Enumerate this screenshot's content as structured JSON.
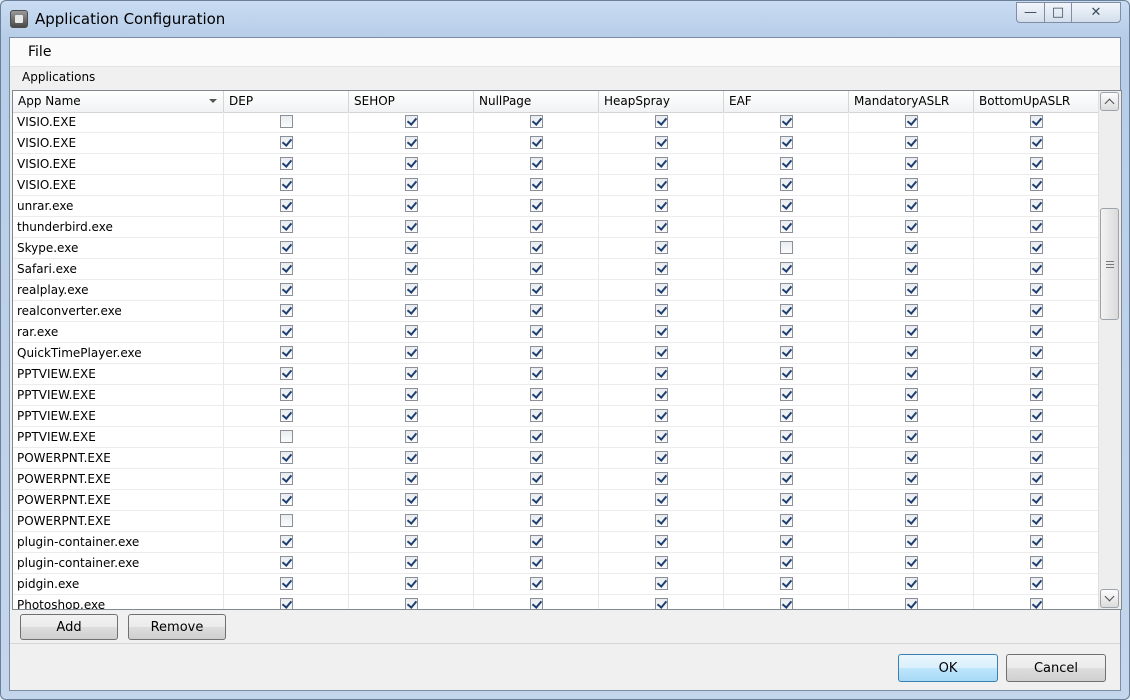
{
  "window": {
    "title": "Application Configuration"
  },
  "caption": {
    "minimize": "—",
    "maximize": "□",
    "close": "✕"
  },
  "menu": {
    "file": "File"
  },
  "grid": {
    "group_label": "Applications",
    "columns": [
      "App Name",
      "DEP",
      "SEHOP",
      "NullPage",
      "HeapSpray",
      "EAF",
      "MandatoryASLR",
      "BottomUpASLR"
    ],
    "rows": [
      {
        "name": "VISIO.EXE",
        "checks": [
          false,
          true,
          true,
          true,
          true,
          true,
          true
        ]
      },
      {
        "name": "VISIO.EXE",
        "checks": [
          true,
          true,
          true,
          true,
          true,
          true,
          true
        ]
      },
      {
        "name": "VISIO.EXE",
        "checks": [
          true,
          true,
          true,
          true,
          true,
          true,
          true
        ]
      },
      {
        "name": "VISIO.EXE",
        "checks": [
          true,
          true,
          true,
          true,
          true,
          true,
          true
        ]
      },
      {
        "name": "unrar.exe",
        "checks": [
          true,
          true,
          true,
          true,
          true,
          true,
          true
        ]
      },
      {
        "name": "thunderbird.exe",
        "checks": [
          true,
          true,
          true,
          true,
          true,
          true,
          true
        ]
      },
      {
        "name": "Skype.exe",
        "checks": [
          true,
          true,
          true,
          true,
          false,
          true,
          true
        ]
      },
      {
        "name": "Safari.exe",
        "checks": [
          true,
          true,
          true,
          true,
          true,
          true,
          true
        ]
      },
      {
        "name": "realplay.exe",
        "checks": [
          true,
          true,
          true,
          true,
          true,
          true,
          true
        ]
      },
      {
        "name": "realconverter.exe",
        "checks": [
          true,
          true,
          true,
          true,
          true,
          true,
          true
        ]
      },
      {
        "name": "rar.exe",
        "checks": [
          true,
          true,
          true,
          true,
          true,
          true,
          true
        ]
      },
      {
        "name": "QuickTimePlayer.exe",
        "checks": [
          true,
          true,
          true,
          true,
          true,
          true,
          true
        ]
      },
      {
        "name": "PPTVIEW.EXE",
        "checks": [
          true,
          true,
          true,
          true,
          true,
          true,
          true
        ]
      },
      {
        "name": "PPTVIEW.EXE",
        "checks": [
          true,
          true,
          true,
          true,
          true,
          true,
          true
        ]
      },
      {
        "name": "PPTVIEW.EXE",
        "checks": [
          true,
          true,
          true,
          true,
          true,
          true,
          true
        ]
      },
      {
        "name": "PPTVIEW.EXE",
        "checks": [
          false,
          true,
          true,
          true,
          true,
          true,
          true
        ]
      },
      {
        "name": "POWERPNT.EXE",
        "checks": [
          true,
          true,
          true,
          true,
          true,
          true,
          true
        ]
      },
      {
        "name": "POWERPNT.EXE",
        "checks": [
          true,
          true,
          true,
          true,
          true,
          true,
          true
        ]
      },
      {
        "name": "POWERPNT.EXE",
        "checks": [
          true,
          true,
          true,
          true,
          true,
          true,
          true
        ]
      },
      {
        "name": "POWERPNT.EXE",
        "checks": [
          false,
          true,
          true,
          true,
          true,
          true,
          true
        ]
      },
      {
        "name": "plugin-container.exe",
        "checks": [
          true,
          true,
          true,
          true,
          true,
          true,
          true
        ]
      },
      {
        "name": "plugin-container.exe",
        "checks": [
          true,
          true,
          true,
          true,
          true,
          true,
          true
        ]
      },
      {
        "name": "pidgin.exe",
        "checks": [
          true,
          true,
          true,
          true,
          true,
          true,
          true
        ]
      },
      {
        "name": "Photoshop.exe",
        "checks": [
          true,
          true,
          true,
          true,
          true,
          true,
          true
        ]
      }
    ]
  },
  "buttons": {
    "add": "Add",
    "remove": "Remove",
    "ok": "OK",
    "cancel": "Cancel"
  }
}
